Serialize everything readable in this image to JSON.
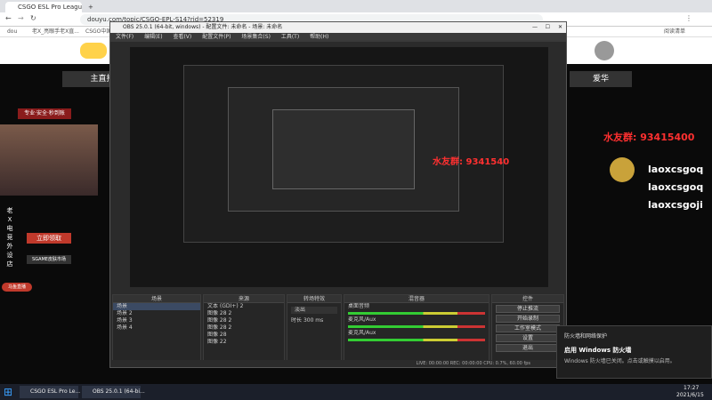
{
  "browser": {
    "tabs": [
      {
        "label": "CSGO ESL Pro League S14",
        "active": true
      },
      {
        "label": "+",
        "active": false
      }
    ],
    "url": "douyu.com/topic/CSGO-EPL-S14?rid=52319",
    "bookmarks": [
      "dou",
      "老X_亮眼手老X直...",
      "CSGO中国...",
      "阅读清单"
    ]
  },
  "stream": {
    "main_host": "主直播",
    "host_name": "爱华",
    "promo_lines": [
      "专业·安全·秒到账",
      "立即领取",
      "SGAME皮肤市场"
    ],
    "side_text": [
      "老",
      "X",
      "电",
      "竞",
      "外",
      "设",
      "店"
    ],
    "qq_label": "水友群: 93415400",
    "qq_small": "水友群: 9341540",
    "ids": [
      "laoxcsgoq",
      "laoxcsgoq",
      "laoxcsgoji"
    ],
    "banner": "马鱼直播"
  },
  "obs": {
    "title": "OBS 25.0.1 (64-bit, windows) - 配置文件: 未命名 - 场景: 未命名",
    "menu": [
      "文件(F)",
      "编辑(E)",
      "查看(V)",
      "配置文件(P)",
      "场景集合(S)",
      "工具(T)",
      "帮助(H)"
    ],
    "docks": {
      "scenes": {
        "header": "场景",
        "items": [
          "场景",
          "场景 2",
          "场景 3",
          "场景 4"
        ]
      },
      "sources": {
        "header": "来源",
        "items": [
          "文本 (GDI+) 2",
          "图像 28 2",
          "图像 28 2",
          "图像 28 2",
          "图像 28",
          "图像 22"
        ]
      },
      "transitions": {
        "header": "转场特效",
        "type": "淡出",
        "duration_label": "时长",
        "duration": "300 ms"
      },
      "mixer": {
        "header": "混音器",
        "tracks": [
          "桌面音频",
          "麦克风/Aux",
          "麦克风/Aux"
        ],
        "db": "0.0 dB"
      },
      "controls": {
        "header": "控件",
        "buttons": [
          "停止推流",
          "开始录制",
          "工作室模式",
          "设置",
          "退出"
        ]
      }
    },
    "status": "LIVE: 00:00:00   REC: 00:00:00   CPU: 0.7%, 60.00 fps"
  },
  "notification": {
    "header": "防火墙和网络保护",
    "title": "启用 Windows 防火墙",
    "body": "Windows 防火墙已关闭。点击或触摸以启用。"
  },
  "taskbar": {
    "items": [
      "CSGO ESL Pro Le...",
      "OBS 25.0.1 (64-bi..."
    ],
    "time": "17:27",
    "date": "2021/6/15"
  },
  "colors": {
    "accent": "#d32b2b",
    "gold": "#c9a23a",
    "live_green": "#33cc33"
  }
}
